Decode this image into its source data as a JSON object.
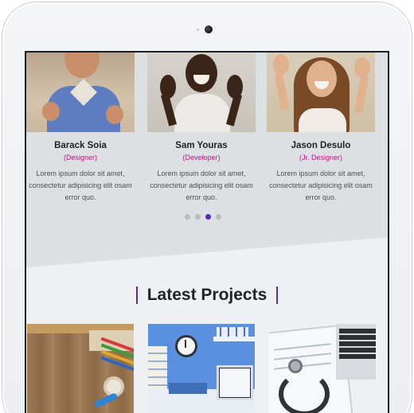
{
  "team": [
    {
      "name": "Barack Soia",
      "role": "(Designer)",
      "bio": "Lorem ipsum dolor sit amet, consectetur adipisicing elit osam error quo."
    },
    {
      "name": "Sam Youras",
      "role": "(Developer)",
      "bio": "Lorem ipsum dolor sit amet, consectetur adipisicing elit osam error quo."
    },
    {
      "name": "Jason Desulo",
      "role": "(Jr. Designer)",
      "bio": "Lorem ipsum dolor sit amet, consectetur adipisicing elit osam error quo."
    }
  ],
  "carousel": {
    "page_count": 4,
    "active_index": 2
  },
  "projects": {
    "title": "Latest Projects",
    "items": [
      "desk-tools-photo",
      "office-shelf-photo",
      "stethoscope-clipboard-photo"
    ]
  },
  "colors": {
    "accent": "#5a2bb0",
    "role": "#c3138a"
  }
}
